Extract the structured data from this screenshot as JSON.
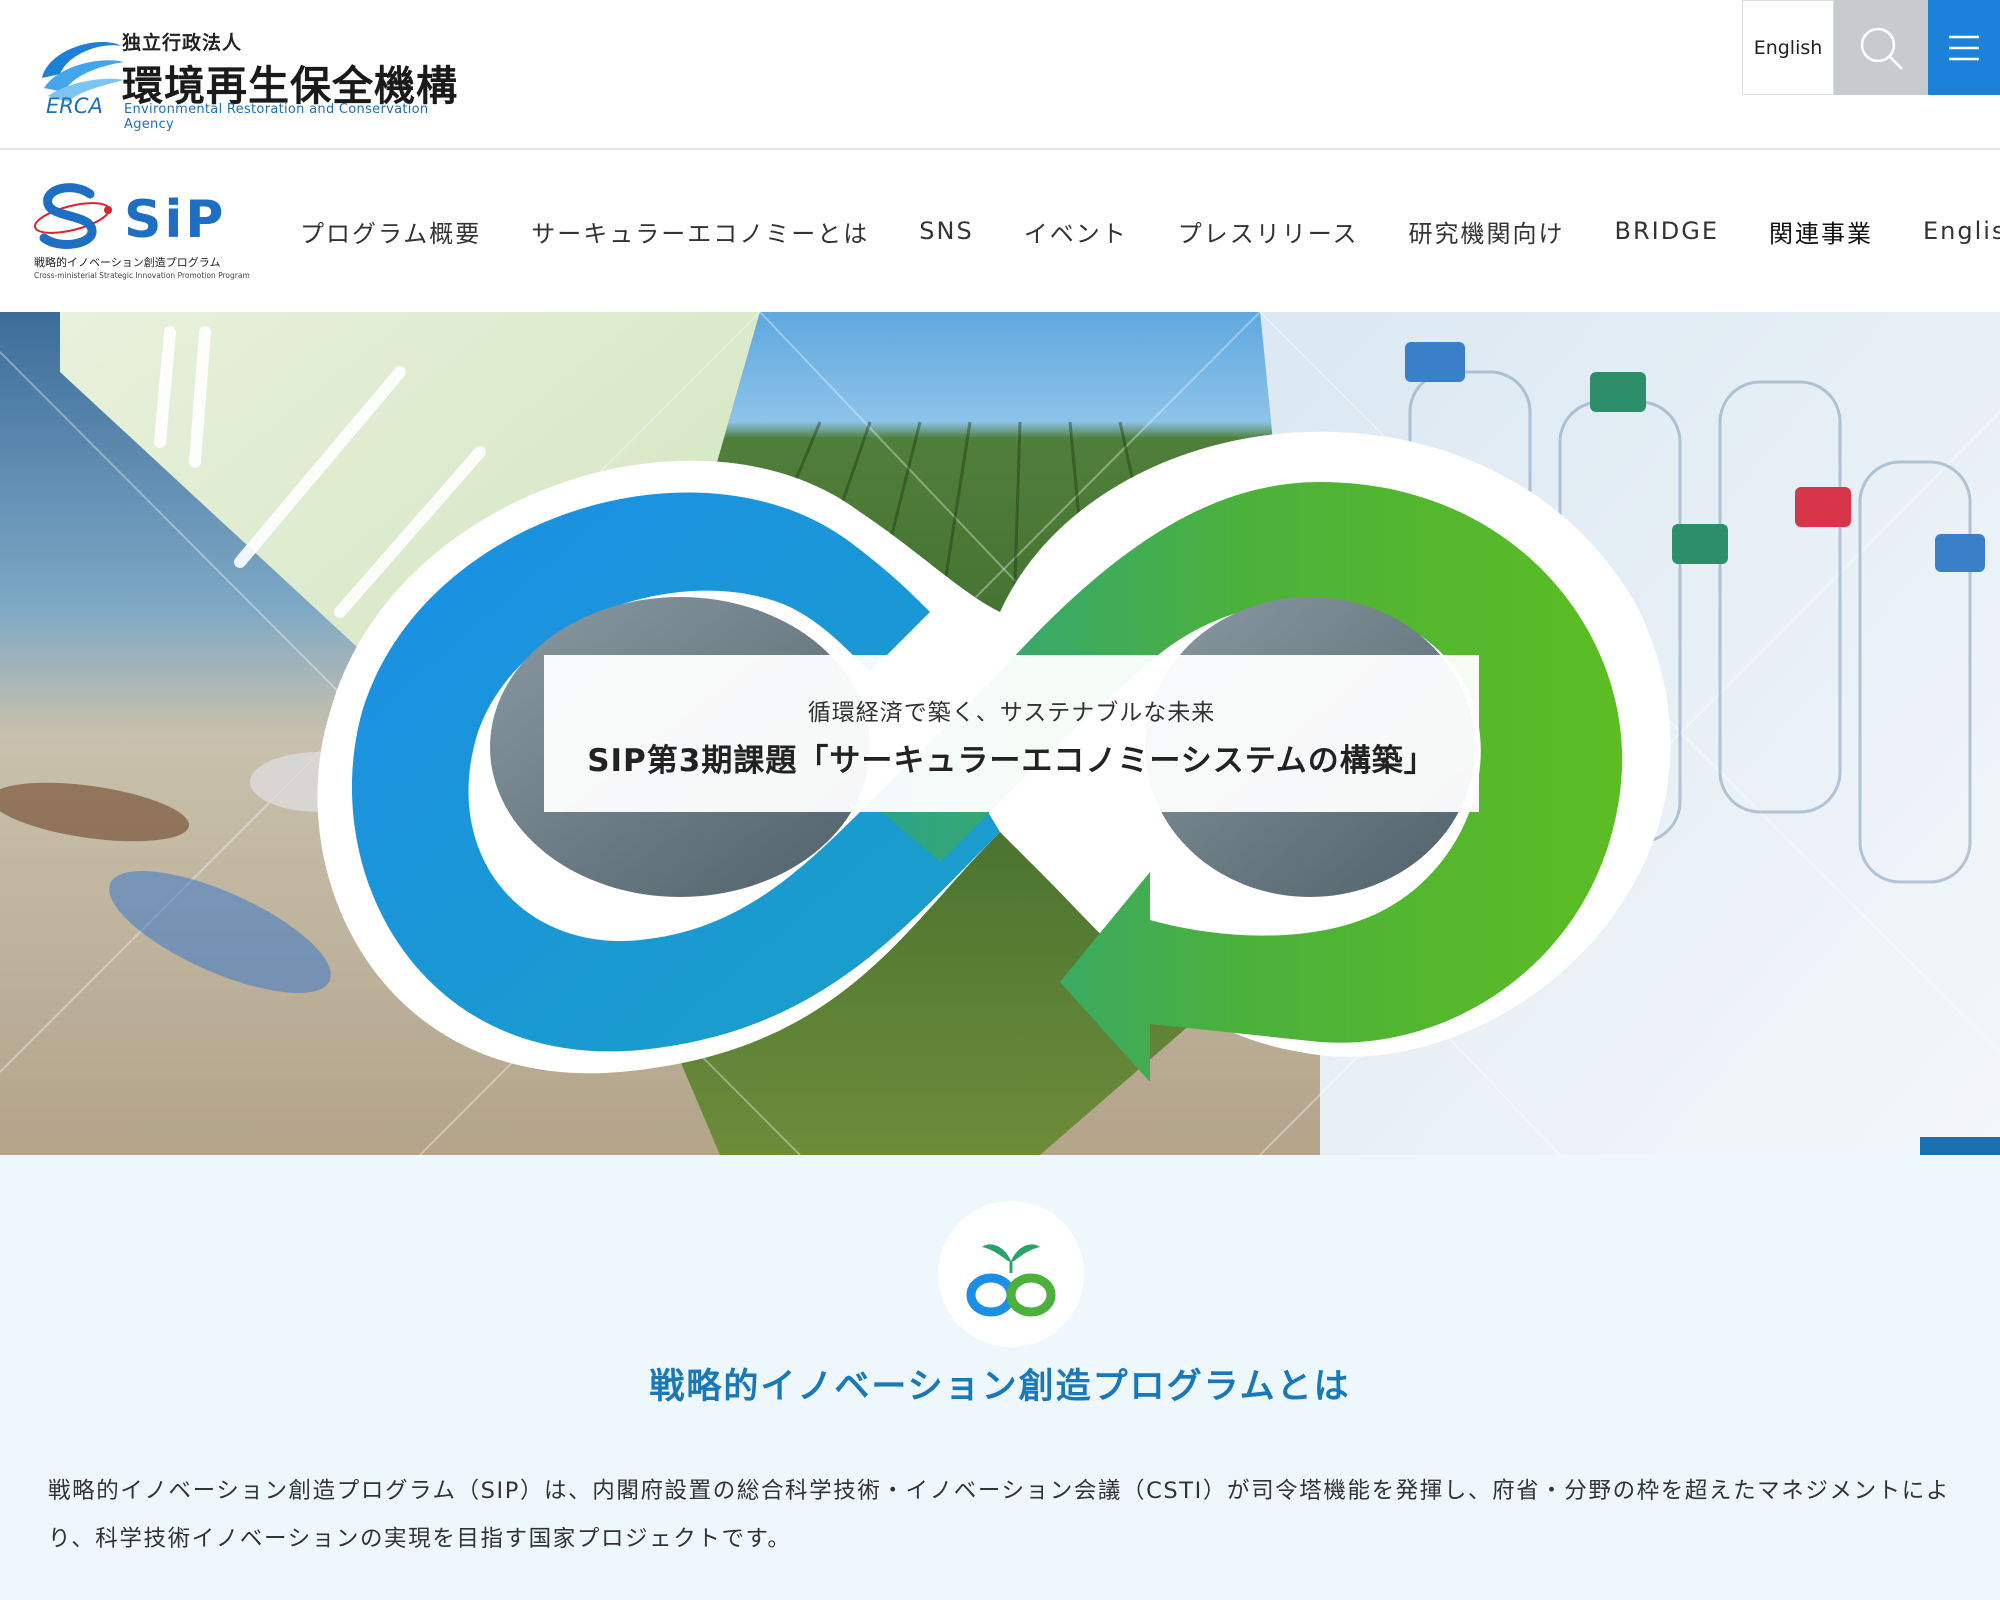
{
  "header": {
    "org_type": "独立行政法人",
    "org_name": "環境再生保全機構",
    "org_name_en": "Environmental Restoration and Conservation Agency",
    "org_abbr": "ERCA",
    "lang_label": "English",
    "search_icon": "search-icon",
    "menu_icon": "hamburger-menu-icon"
  },
  "sip": {
    "logo_text": "SiP",
    "tagline_jp": "戦略的イノベーション創造プログラム",
    "tagline_en": "Cross-ministerial Strategic Innovation Promotion Program"
  },
  "nav": {
    "items": [
      {
        "label": "プログラム概要"
      },
      {
        "label": "サーキュラーエコノミーとは"
      },
      {
        "label": "SNS"
      },
      {
        "label": "イベント"
      },
      {
        "label": "プレスリリース"
      },
      {
        "label": "研究機関向け"
      },
      {
        "label": "BRIDGE"
      },
      {
        "label": "関連事業"
      },
      {
        "label": "English"
      }
    ]
  },
  "hero": {
    "subtitle": "循環経済で築く、サステナブルな未来",
    "title": "SIP第3期課題「サーキュラーエコノミーシステムの構築」",
    "colors": {
      "blue": "#1a8fe3",
      "green": "#54b52a"
    }
  },
  "scroll_top": {
    "icon": "arrow-up-icon"
  },
  "intro": {
    "heading": "戦略的イノベーション創造プログラムとは",
    "body": "戦略的イノベーション創造プログラム（SIP）は、内閣府設置の総合科学技術・イノベーション会議（CSTI）が司令塔機能を発揮し、府省・分野の枠を超えたマネジメントにより、科学技術イノベーションの実現を目指す国家プロジェクトです。",
    "accent": "#1878b9"
  }
}
